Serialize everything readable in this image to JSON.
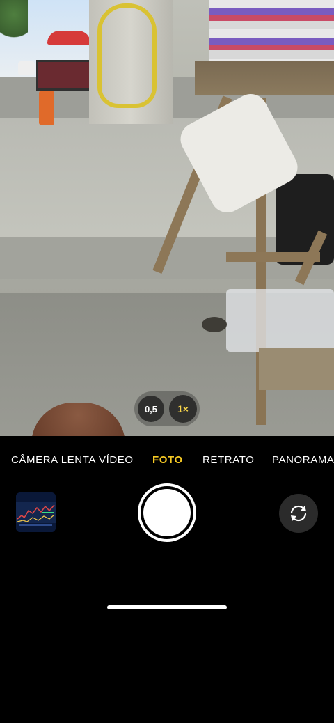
{
  "zoom": {
    "options": [
      {
        "label": "0,5",
        "selected": false
      },
      {
        "label": "1×",
        "selected": true
      }
    ],
    "selected_color": "#f7d44a"
  },
  "modes": {
    "items": [
      {
        "label": "CÂMERA LENTA",
        "active": false
      },
      {
        "label": "VÍDEO",
        "active": false
      },
      {
        "label": "FOTO",
        "active": true
      },
      {
        "label": "RETRATO",
        "active": false
      },
      {
        "label": "PANORAMA",
        "active": false
      }
    ],
    "active_color": "#f6c924"
  },
  "controls": {
    "thumbnail_icon": "last-photo-thumbnail",
    "shutter_icon": "shutter-button",
    "flip_icon": "camera-flip-icon"
  }
}
